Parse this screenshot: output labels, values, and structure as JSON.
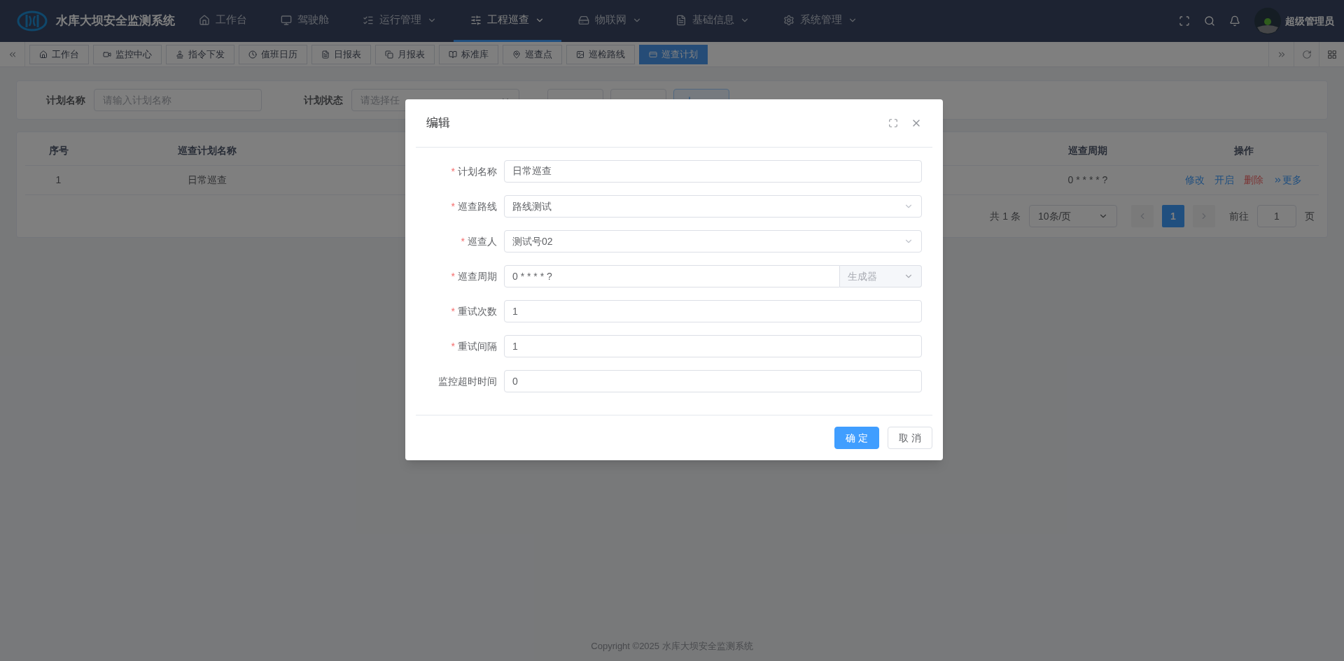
{
  "header": {
    "title": "水库大坝安全监测系统",
    "user": "超级管理员",
    "nav": [
      {
        "label": "工作台",
        "has_caret": false,
        "selected": false
      },
      {
        "label": "驾驶舱",
        "has_caret": false,
        "selected": false
      },
      {
        "label": "运行管理",
        "has_caret": true,
        "selected": false
      },
      {
        "label": "工程巡查",
        "has_caret": true,
        "selected": true
      },
      {
        "label": "物联网",
        "has_caret": true,
        "selected": false
      },
      {
        "label": "基础信息",
        "has_caret": true,
        "selected": false
      },
      {
        "label": "系统管理",
        "has_caret": true,
        "selected": false
      }
    ]
  },
  "tabs": [
    {
      "label": "工作台",
      "selected": false
    },
    {
      "label": "监控中心",
      "selected": false
    },
    {
      "label": "指令下发",
      "selected": false
    },
    {
      "label": "值班日历",
      "selected": false
    },
    {
      "label": "日报表",
      "selected": false
    },
    {
      "label": "月报表",
      "selected": false
    },
    {
      "label": "标准库",
      "selected": false
    },
    {
      "label": "巡查点",
      "selected": false
    },
    {
      "label": "巡检路线",
      "selected": false
    },
    {
      "label": "巡查计划",
      "selected": true
    }
  ],
  "search": {
    "fields": [
      {
        "kind": "input",
        "label": "计划名称",
        "placeholder": "请输入计划名称"
      },
      {
        "kind": "select",
        "label": "计划状态",
        "placeholder": "请选择任"
      }
    ],
    "buttons": [
      {
        "kind": "default"
      },
      {
        "kind": "default"
      },
      {
        "kind": "plain"
      }
    ]
  },
  "table": {
    "columns": [
      "序号",
      "巡查计划名称",
      "巡查周期",
      "操作"
    ],
    "rows": [
      {
        "cells": [
          "1",
          "日常巡查",
          "0 * * * * ?"
        ],
        "actions": [
          {
            "kind": "link",
            "label": "修改"
          },
          {
            "kind": "link",
            "label": "开启"
          },
          {
            "kind": "danger",
            "label": "删除"
          },
          {
            "kind": "more",
            "label": "更多"
          }
        ]
      }
    ],
    "pagination": {
      "total": "共 1 条",
      "page_size": "10条/页",
      "pages": [
        {
          "label": "1",
          "selected": true
        }
      ],
      "goto_label": "前往",
      "goto_value": "1",
      "page_suffix": "页"
    }
  },
  "footer": "Copyright ©2025 水库大坝安全监测系统",
  "dialog": {
    "title": "编辑",
    "required_mark": "*",
    "fields": [
      {
        "kind": "input",
        "label": "计划名称",
        "required": true,
        "value": "日常巡查"
      },
      {
        "kind": "select",
        "label": "巡查路线",
        "required": true,
        "value": "路线测试"
      },
      {
        "kind": "select",
        "label": "巡查人",
        "required": true,
        "value": "测试号02"
      },
      {
        "kind": "cron",
        "label": "巡查周期",
        "required": true,
        "value": "0 * * * * ?",
        "addon": "生成器"
      },
      {
        "kind": "input",
        "label": "重试次数",
        "required": true,
        "value": "1"
      },
      {
        "kind": "input",
        "label": "重试间隔",
        "required": true,
        "value": "1"
      },
      {
        "kind": "input",
        "label": "监控超时时间",
        "required": false,
        "value": "0"
      }
    ],
    "buttons": [
      {
        "kind": "primary",
        "label": "确 定"
      },
      {
        "kind": "default",
        "label": "取 消"
      }
    ]
  }
}
